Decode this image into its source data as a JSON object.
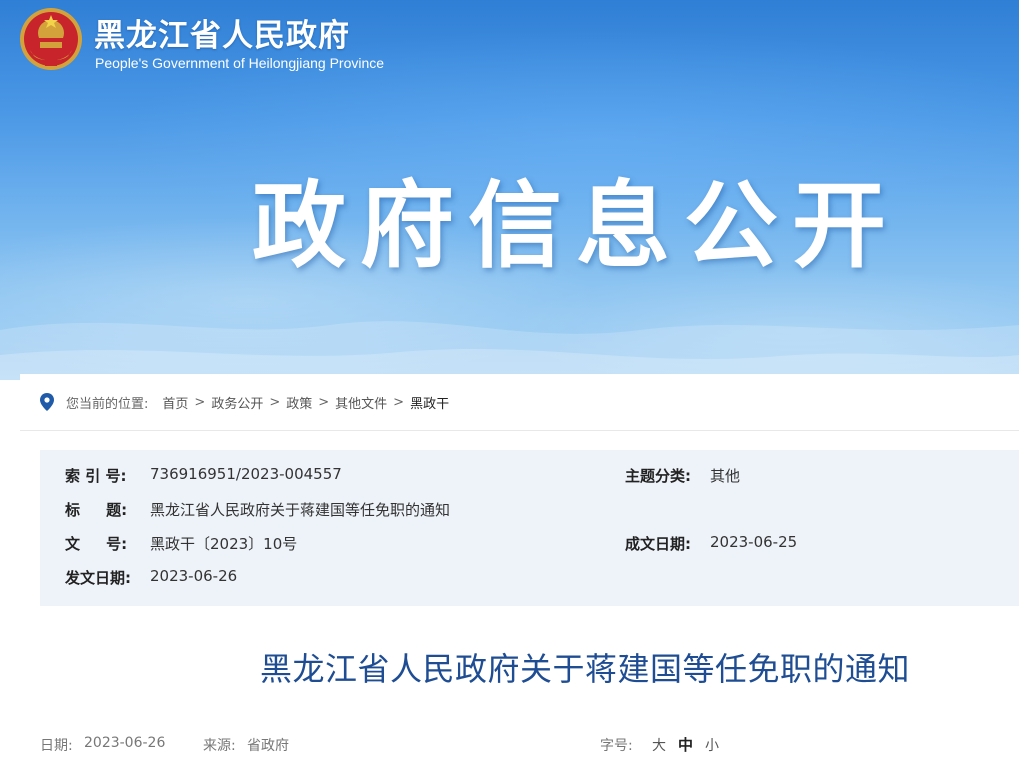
{
  "header": {
    "site_title": "黑龙江省人民政府",
    "site_subtitle": "People's Government of Heilongjiang Province",
    "section_title": "政府信息公开"
  },
  "breadcrumb": {
    "lead": "您当前的位置:",
    "items": [
      "首页",
      "政务公开",
      "政策",
      "其他文件",
      "黑政干"
    ],
    "separator": ">"
  },
  "meta": {
    "index_label": "索 引 号:",
    "index_value": "736916951/2023-004557",
    "topic_label": "主题分类:",
    "topic_value": "其他",
    "title_label": "标     题:",
    "title_value": "黑龙江省人民政府关于蒋建国等任免职的通知",
    "docno_label": "文     号:",
    "docno_value": "黑政干〔2023〕10号",
    "created_label": "成文日期:",
    "created_value": "2023-06-25",
    "published_label": "发文日期:",
    "published_value": "2023-06-26"
  },
  "document": {
    "title": "黑龙江省人民政府关于蒋建国等任免职的通知"
  },
  "footer": {
    "date_label": "日期:",
    "date_value": "2023-06-26",
    "source_label": "来源:",
    "source_value": "省政府",
    "fontsize_label": "字号:",
    "fontsize_options": [
      "大",
      "中",
      "小"
    ],
    "fontsize_selected": "中"
  },
  "colors": {
    "title_blue": "#1f4d93",
    "meta_bg": "#eef3f9",
    "pin_blue": "#1f5ba8"
  }
}
